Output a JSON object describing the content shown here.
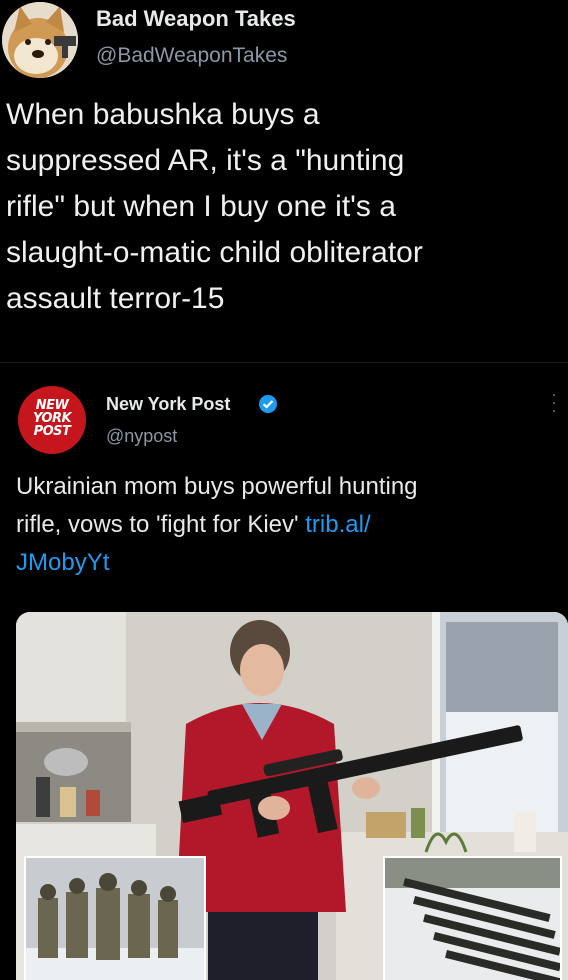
{
  "tweet": {
    "author_name": "Bad Weapon Takes",
    "author_handle": "@BadWeaponTakes",
    "text_lines": [
      "When babushka buys a",
      "suppressed AR, it's a \"hunting",
      "rifle\" but when I buy one it's a",
      "slaught-o-matic child obliterator",
      "assault terror-15"
    ]
  },
  "quoted": {
    "logo_lines": [
      "NEW",
      "YORK",
      "POST"
    ],
    "author_name": "New York Post",
    "author_handle": "@nypost",
    "text_line1": "Ukrainian mom buys powerful hunting",
    "text_line2_plain": "rifle, vows to 'fight for Kiev' ",
    "link_part1": "trib.al/",
    "link_part2": "JMobyYt"
  },
  "colors": {
    "background": "#000000",
    "text": "#e7e9ea",
    "secondary_text": "#8b98a5",
    "link": "#1d9bf0",
    "nypost_red": "#c4161c",
    "verified_blue": "#1d9bf0"
  },
  "icons": [
    "doge-avatar",
    "nypost-logo",
    "verified-badge-icon",
    "more-options-icon"
  ]
}
